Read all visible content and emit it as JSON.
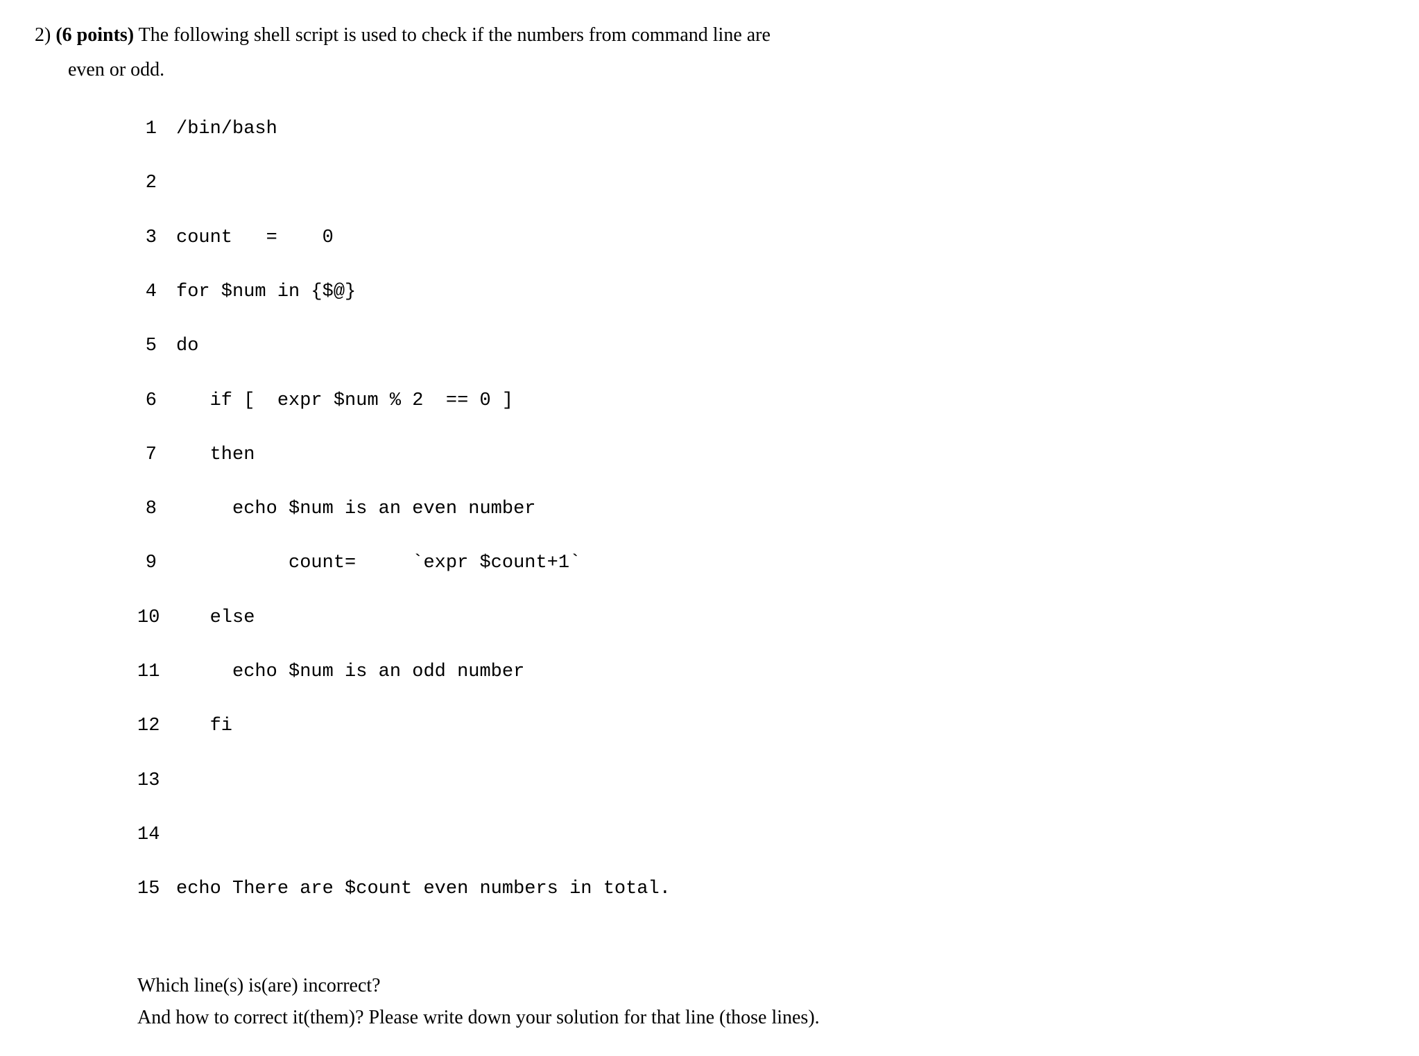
{
  "question": {
    "number": "2)",
    "points": "(6 points)",
    "text_line1": " The following shell script is used to check if the numbers from command line are",
    "text_line2": "even or odd."
  },
  "code": {
    "lines": [
      {
        "num": "1",
        "content": "/bin/bash"
      },
      {
        "num": "2",
        "content": ""
      },
      {
        "num": "3",
        "content": "count   =    0"
      },
      {
        "num": "4",
        "content": "for $num in {$@}"
      },
      {
        "num": "5",
        "content": "do"
      },
      {
        "num": "6",
        "content": "   if [  expr $num % 2  == 0 ]"
      },
      {
        "num": "7",
        "content": "   then"
      },
      {
        "num": "8",
        "content": "     echo $num is an even number"
      },
      {
        "num": "9",
        "content": "          count=     `expr $count+1`"
      },
      {
        "num": "10",
        "content": "   else"
      },
      {
        "num": "11",
        "content": "     echo $num is an odd number"
      },
      {
        "num": "12",
        "content": "   fi"
      },
      {
        "num": "13",
        "content": ""
      },
      {
        "num": "14",
        "content": ""
      },
      {
        "num": "15",
        "content": "echo There are $count even numbers in total."
      }
    ]
  },
  "footer": {
    "line1": "Which line(s) is(are) incorrect?",
    "line2": "And how to correct it(them)? Please write down your solution for that line (those lines)."
  }
}
